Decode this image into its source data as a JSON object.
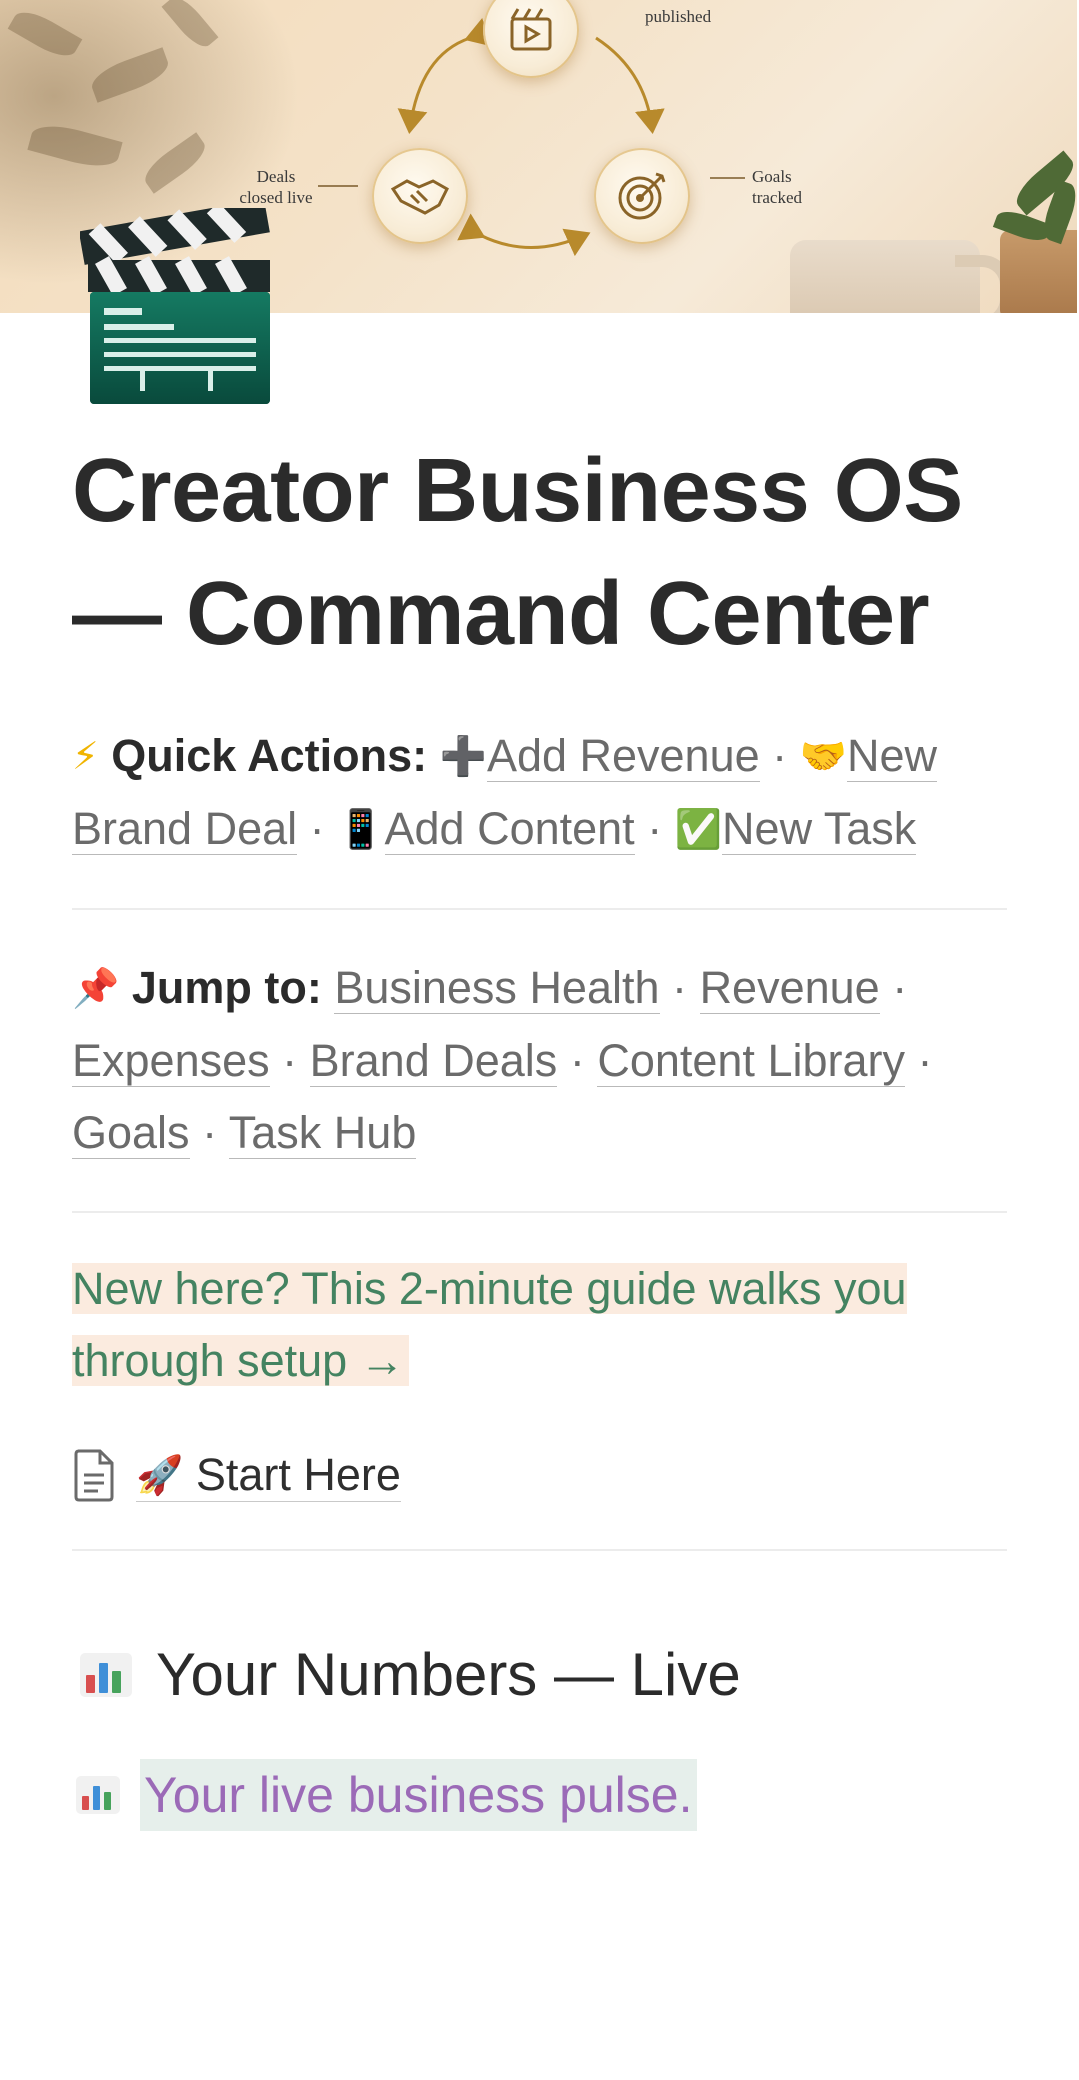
{
  "cover": {
    "labels": {
      "top": "published",
      "left": "Deals\nclosed live",
      "right": "Goals\ntracked"
    }
  },
  "page": {
    "icon": "clapperboard-icon",
    "title": "Creator Business OS — Command Center"
  },
  "quick_actions": {
    "label": "Quick Actions:",
    "icon": "lightning-icon",
    "links": [
      {
        "icon": "plus-icon",
        "label": "Add Revenue"
      },
      {
        "icon": "handshake-icon",
        "label": "New Brand Deal"
      },
      {
        "icon": "phone-icon",
        "label": "Add Content"
      },
      {
        "icon": "checkmark-icon",
        "label": "New Task"
      }
    ],
    "separator": "·"
  },
  "jump_to": {
    "label": "Jump to:",
    "icon": "pushpin-icon",
    "links": [
      "Business Health",
      "Revenue",
      "Expenses",
      "Brand Deals",
      "Content Library",
      "Goals",
      "Task Hub"
    ]
  },
  "callout": {
    "text": "New here? This 2-minute guide walks you through setup →",
    "color": "#448361",
    "background": "#fbebdf"
  },
  "start_page": {
    "icon": "rocket-icon",
    "label": "Start Here"
  },
  "numbers_section": {
    "heading": "Your Numbers — Live",
    "icon": "bar-chart-icon",
    "pulse_text": "Your live business pulse.",
    "pulse_color": "#9b6ab7",
    "pulse_background": "#e6efeb"
  }
}
